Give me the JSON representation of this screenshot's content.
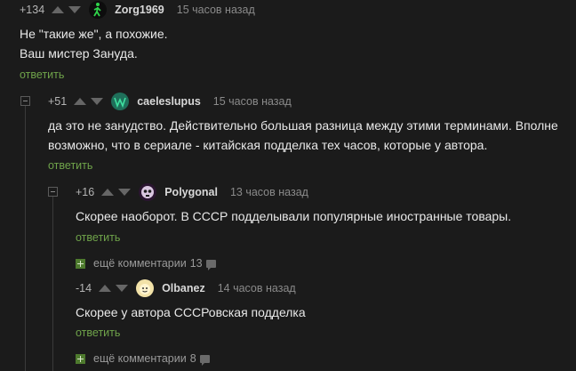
{
  "comments": [
    {
      "rating": "+134",
      "username": "Zorg1969",
      "time": "15 часов назад",
      "lines": [
        "Не \"такие же\", а похожие.",
        "Ваш мистер Зануда."
      ],
      "reply": "ответить"
    },
    {
      "rating": "+51",
      "username": "caeleslupus",
      "time": "15 часов назад",
      "lines": [
        "да это не занудство. Действительно большая разница между этими терминами. Вполне",
        "возможно, что в сериале - китайская подделка тех часов, которые у автора."
      ],
      "reply": "ответить"
    },
    {
      "rating": "+16",
      "username": "Polygonal",
      "time": "13 часов назад",
      "lines": [
        "Скорее наоборот. В СССР подделывали популярные иностранные товары."
      ],
      "reply": "ответить",
      "more_label": "ещё комментарии",
      "more_count": "13"
    },
    {
      "rating": "-14",
      "username": "Olbanez",
      "time": "14 часов назад",
      "lines": [
        "Скорее у автора СССРовская подделка"
      ],
      "reply": "ответить",
      "more_label": "ещё комментарии",
      "more_count": "8"
    }
  ],
  "colors": {
    "background": "#1b1b1b",
    "reply_link": "#6fa34a",
    "more_plus": "#4e7a2e"
  }
}
